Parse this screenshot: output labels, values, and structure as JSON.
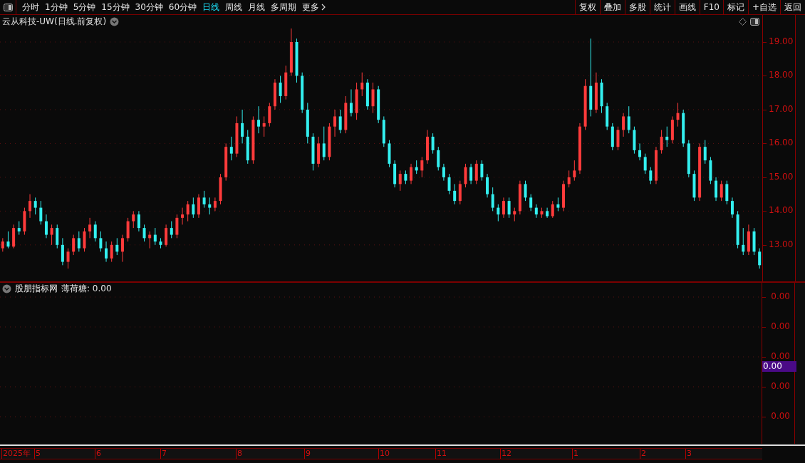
{
  "toolbar": {
    "periods": [
      {
        "label": "分时",
        "selected": false
      },
      {
        "label": "1分钟",
        "selected": false
      },
      {
        "label": "5分钟",
        "selected": false
      },
      {
        "label": "15分钟",
        "selected": false
      },
      {
        "label": "30分钟",
        "selected": false
      },
      {
        "label": "60分钟",
        "selected": false
      },
      {
        "label": "日线",
        "selected": true
      },
      {
        "label": "周线",
        "selected": false
      },
      {
        "label": "月线",
        "selected": false
      },
      {
        "label": "多周期",
        "selected": false
      },
      {
        "label": "更多",
        "selected": false
      }
    ],
    "actions": [
      "复权",
      "叠加",
      "多股",
      "统计",
      "画线",
      "F10",
      "标记",
      "+自选",
      "返回"
    ]
  },
  "main_chart": {
    "title": "云从科技-UW(日线.前复权)",
    "chart_data": {
      "type": "candlestick",
      "grid": true,
      "ylim": [
        11.88,
        19.8
      ],
      "categories": [
        null,
        null,
        null,
        null,
        null,
        null,
        null,
        null,
        null,
        null,
        null,
        null,
        null,
        null,
        null,
        null,
        null,
        null,
        null,
        null,
        null,
        null,
        null,
        null,
        null,
        null,
        null,
        null,
        null,
        null,
        null,
        null,
        null,
        null,
        null,
        null,
        null,
        null,
        null,
        null,
        null,
        null,
        null,
        null,
        null,
        null,
        null,
        null,
        null,
        null,
        null,
        null,
        null,
        null,
        null,
        null,
        null,
        null,
        null,
        null,
        null,
        null,
        null,
        null,
        null,
        null,
        null,
        null,
        null,
        null,
        null,
        null,
        null,
        null,
        null,
        null,
        null,
        null,
        null,
        null,
        null,
        null,
        null,
        null,
        null,
        null,
        null,
        null,
        null,
        null,
        null,
        null,
        null,
        null,
        null,
        null,
        null,
        null,
        null,
        null,
        null,
        null,
        null,
        null,
        null,
        null,
        null,
        null,
        null,
        null,
        null,
        null,
        null,
        null,
        null,
        null,
        null,
        null,
        null,
        null,
        null,
        null,
        null,
        null,
        null,
        null,
        null,
        null,
        null,
        null,
        null,
        null,
        null,
        null,
        null,
        null,
        null,
        null,
        null,
        null
      ],
      "yticks": [
        {
          "value": 19,
          "label": "19.00"
        },
        {
          "value": 18,
          "label": "18.00"
        },
        {
          "value": 17,
          "label": "17.00"
        },
        {
          "value": 16,
          "label": "16.00"
        },
        {
          "value": 15,
          "label": "15.00"
        },
        {
          "value": 14,
          "label": "14.00"
        },
        {
          "value": 13,
          "label": "13.00"
        }
      ],
      "ohlc": [
        [
          12.9,
          13.2,
          12.8,
          13.1
        ],
        [
          13.1,
          13.4,
          12.9,
          12.95
        ],
        [
          12.95,
          13.6,
          12.9,
          13.5
        ],
        [
          13.5,
          13.7,
          13.3,
          13.4
        ],
        [
          13.4,
          14.1,
          13.3,
          14.0
        ],
        [
          14.0,
          14.5,
          13.8,
          14.3
        ],
        [
          14.3,
          14.4,
          13.9,
          14.1
        ],
        [
          14.1,
          14.3,
          13.6,
          13.7
        ],
        [
          13.7,
          13.9,
          13.2,
          13.3
        ],
        [
          13.3,
          13.6,
          13.0,
          13.5
        ],
        [
          13.5,
          13.6,
          12.9,
          13.0
        ],
        [
          13.0,
          13.2,
          12.4,
          12.5
        ],
        [
          12.5,
          12.9,
          12.3,
          12.8
        ],
        [
          12.8,
          13.3,
          12.7,
          13.2
        ],
        [
          13.2,
          13.4,
          12.8,
          12.9
        ],
        [
          12.9,
          13.5,
          12.8,
          13.4
        ],
        [
          13.4,
          13.8,
          13.2,
          13.6
        ],
        [
          13.6,
          13.7,
          13.1,
          13.2
        ],
        [
          13.2,
          13.4,
          12.8,
          12.9
        ],
        [
          12.9,
          13.1,
          12.5,
          12.6
        ],
        [
          12.6,
          13.1,
          12.5,
          13.0
        ],
        [
          13.0,
          13.2,
          12.7,
          12.8
        ],
        [
          12.8,
          13.3,
          12.5,
          13.2
        ],
        [
          13.2,
          13.8,
          13.1,
          13.7
        ],
        [
          13.7,
          14.0,
          13.5,
          13.9
        ],
        [
          13.9,
          14.0,
          13.4,
          13.5
        ],
        [
          13.5,
          13.6,
          13.1,
          13.2
        ],
        [
          13.2,
          13.4,
          12.9,
          13.3
        ],
        [
          13.3,
          13.5,
          13.0,
          13.1
        ],
        [
          13.1,
          13.2,
          12.9,
          13.0
        ],
        [
          13.0,
          13.6,
          12.95,
          13.5
        ],
        [
          13.5,
          13.7,
          13.2,
          13.3
        ],
        [
          13.3,
          13.9,
          13.2,
          13.8
        ],
        [
          13.8,
          14.1,
          13.6,
          13.9
        ],
        [
          13.9,
          14.3,
          13.7,
          14.2
        ],
        [
          14.2,
          14.4,
          13.8,
          13.9
        ],
        [
          13.9,
          14.5,
          13.8,
          14.4
        ],
        [
          14.4,
          14.6,
          14.1,
          14.2
        ],
        [
          14.2,
          14.4,
          13.9,
          14.1
        ],
        [
          14.1,
          14.4,
          14.0,
          14.3
        ],
        [
          14.3,
          15.1,
          14.2,
          15.0
        ],
        [
          15.0,
          16.0,
          14.9,
          15.9
        ],
        [
          15.9,
          16.2,
          15.5,
          15.7
        ],
        [
          15.7,
          16.8,
          15.6,
          16.6
        ],
        [
          16.6,
          17.0,
          16.0,
          16.2
        ],
        [
          16.2,
          16.4,
          15.4,
          15.5
        ],
        [
          15.5,
          16.8,
          15.4,
          16.7
        ],
        [
          16.7,
          17.1,
          16.3,
          16.5
        ],
        [
          16.5,
          16.8,
          16.2,
          16.6
        ],
        [
          16.6,
          17.2,
          16.5,
          17.1
        ],
        [
          17.1,
          17.9,
          17.0,
          17.8
        ],
        [
          17.8,
          18.0,
          17.2,
          17.4
        ],
        [
          17.4,
          18.3,
          17.3,
          18.1
        ],
        [
          18.1,
          19.4,
          18.0,
          19.0
        ],
        [
          19.0,
          19.1,
          17.8,
          18.0
        ],
        [
          18.0,
          18.1,
          16.9,
          17.0
        ],
        [
          17.0,
          17.2,
          16.0,
          16.2
        ],
        [
          16.2,
          16.3,
          15.2,
          15.4
        ],
        [
          15.4,
          16.2,
          15.3,
          16.0
        ],
        [
          16.0,
          16.5,
          15.5,
          15.6
        ],
        [
          15.6,
          16.6,
          15.5,
          16.5
        ],
        [
          16.5,
          17.0,
          16.2,
          16.8
        ],
        [
          16.8,
          17.0,
          16.3,
          16.4
        ],
        [
          16.4,
          17.4,
          16.3,
          17.2
        ],
        [
          17.2,
          17.6,
          16.8,
          16.9
        ],
        [
          16.9,
          17.8,
          16.7,
          17.6
        ],
        [
          17.6,
          18.1,
          17.4,
          17.8
        ],
        [
          17.8,
          17.9,
          17.0,
          17.1
        ],
        [
          17.1,
          17.8,
          16.9,
          17.6
        ],
        [
          17.6,
          17.7,
          16.6,
          16.7
        ],
        [
          16.7,
          16.8,
          15.9,
          16.0
        ],
        [
          16.0,
          16.1,
          15.3,
          15.4
        ],
        [
          15.4,
          15.5,
          14.7,
          14.8
        ],
        [
          14.8,
          15.2,
          14.6,
          15.1
        ],
        [
          15.1,
          15.2,
          14.8,
          14.9
        ],
        [
          14.9,
          15.4,
          14.8,
          15.3
        ],
        [
          15.3,
          15.5,
          15.1,
          15.2
        ],
        [
          15.2,
          15.6,
          15.0,
          15.5
        ],
        [
          15.5,
          16.4,
          15.4,
          16.2
        ],
        [
          16.2,
          16.3,
          15.7,
          15.8
        ],
        [
          15.8,
          15.9,
          15.2,
          15.3
        ],
        [
          15.3,
          15.4,
          14.9,
          15.0
        ],
        [
          15.0,
          15.1,
          14.5,
          14.6
        ],
        [
          14.6,
          14.8,
          14.2,
          14.3
        ],
        [
          14.3,
          14.9,
          14.2,
          14.8
        ],
        [
          14.8,
          15.4,
          14.7,
          15.3
        ],
        [
          15.3,
          15.4,
          14.8,
          14.9
        ],
        [
          14.9,
          15.5,
          14.8,
          15.4
        ],
        [
          15.4,
          15.5,
          14.9,
          15.0
        ],
        [
          15.0,
          15.1,
          14.4,
          14.5
        ],
        [
          14.5,
          14.7,
          14.0,
          14.1
        ],
        [
          14.1,
          14.2,
          13.7,
          13.9
        ],
        [
          13.9,
          14.4,
          13.8,
          14.3
        ],
        [
          14.3,
          14.4,
          13.8,
          13.9
        ],
        [
          13.9,
          14.1,
          13.7,
          14.0
        ],
        [
          14.0,
          14.9,
          13.9,
          14.8
        ],
        [
          14.8,
          14.9,
          14.3,
          14.4
        ],
        [
          14.4,
          14.5,
          14.0,
          14.1
        ],
        [
          14.1,
          14.2,
          13.8,
          13.9
        ],
        [
          13.9,
          14.1,
          13.8,
          14.0
        ],
        [
          14.0,
          14.1,
          13.8,
          13.85
        ],
        [
          13.85,
          14.3,
          13.8,
          14.2
        ],
        [
          14.2,
          14.4,
          14.0,
          14.1
        ],
        [
          14.1,
          14.9,
          14.0,
          14.8
        ],
        [
          14.8,
          15.2,
          14.7,
          15.0
        ],
        [
          15.0,
          15.5,
          14.9,
          15.2
        ],
        [
          15.2,
          16.6,
          15.1,
          16.5
        ],
        [
          16.5,
          17.9,
          16.4,
          17.7
        ],
        [
          17.7,
          19.1,
          16.8,
          17.0
        ],
        [
          17.0,
          18.1,
          16.9,
          17.8
        ],
        [
          17.8,
          17.9,
          16.9,
          17.1
        ],
        [
          17.1,
          17.2,
          16.4,
          16.5
        ],
        [
          16.5,
          16.6,
          15.8,
          15.9
        ],
        [
          15.9,
          16.5,
          15.8,
          16.4
        ],
        [
          16.4,
          16.9,
          16.2,
          16.8
        ],
        [
          16.8,
          17.1,
          16.3,
          16.4
        ],
        [
          16.4,
          16.5,
          15.7,
          15.8
        ],
        [
          15.8,
          16.0,
          15.5,
          15.6
        ],
        [
          15.6,
          15.7,
          15.1,
          15.2
        ],
        [
          15.2,
          15.3,
          14.8,
          14.9
        ],
        [
          14.9,
          15.9,
          14.8,
          15.8
        ],
        [
          15.8,
          16.4,
          15.7,
          16.2
        ],
        [
          16.2,
          16.5,
          15.9,
          16.1
        ],
        [
          16.1,
          16.8,
          16.0,
          16.7
        ],
        [
          16.7,
          17.2,
          16.5,
          16.9
        ],
        [
          16.9,
          17.0,
          15.9,
          16.0
        ],
        [
          16.0,
          16.1,
          15.0,
          15.1
        ],
        [
          15.1,
          15.2,
          14.3,
          14.4
        ],
        [
          14.4,
          16.0,
          14.3,
          15.9
        ],
        [
          15.9,
          16.1,
          15.4,
          15.5
        ],
        [
          15.5,
          15.6,
          14.8,
          14.9
        ],
        [
          14.9,
          15.0,
          14.3,
          14.4
        ],
        [
          14.4,
          14.9,
          14.3,
          14.8
        ],
        [
          14.8,
          14.9,
          14.2,
          14.3
        ],
        [
          14.3,
          14.4,
          13.8,
          13.9
        ],
        [
          13.9,
          14.0,
          12.9,
          13.0
        ],
        [
          13.0,
          13.5,
          12.7,
          12.8
        ],
        [
          12.8,
          13.6,
          12.7,
          13.4
        ],
        [
          13.4,
          13.5,
          12.7,
          12.8
        ],
        [
          12.8,
          12.9,
          12.3,
          12.4
        ]
      ]
    }
  },
  "indicator": {
    "name": "股朋指标网",
    "value_label": "薄荷糖: 0.00",
    "y_ticks": [
      "0.00",
      "0.00",
      "0.00",
      "0.00",
      "0.00"
    ],
    "current_value": "0.00"
  },
  "time_axis": {
    "labels": [
      "2025年",
      "5",
      "6",
      "7",
      "8",
      "9",
      "10",
      "11",
      "12",
      "1",
      "2",
      "3"
    ]
  }
}
